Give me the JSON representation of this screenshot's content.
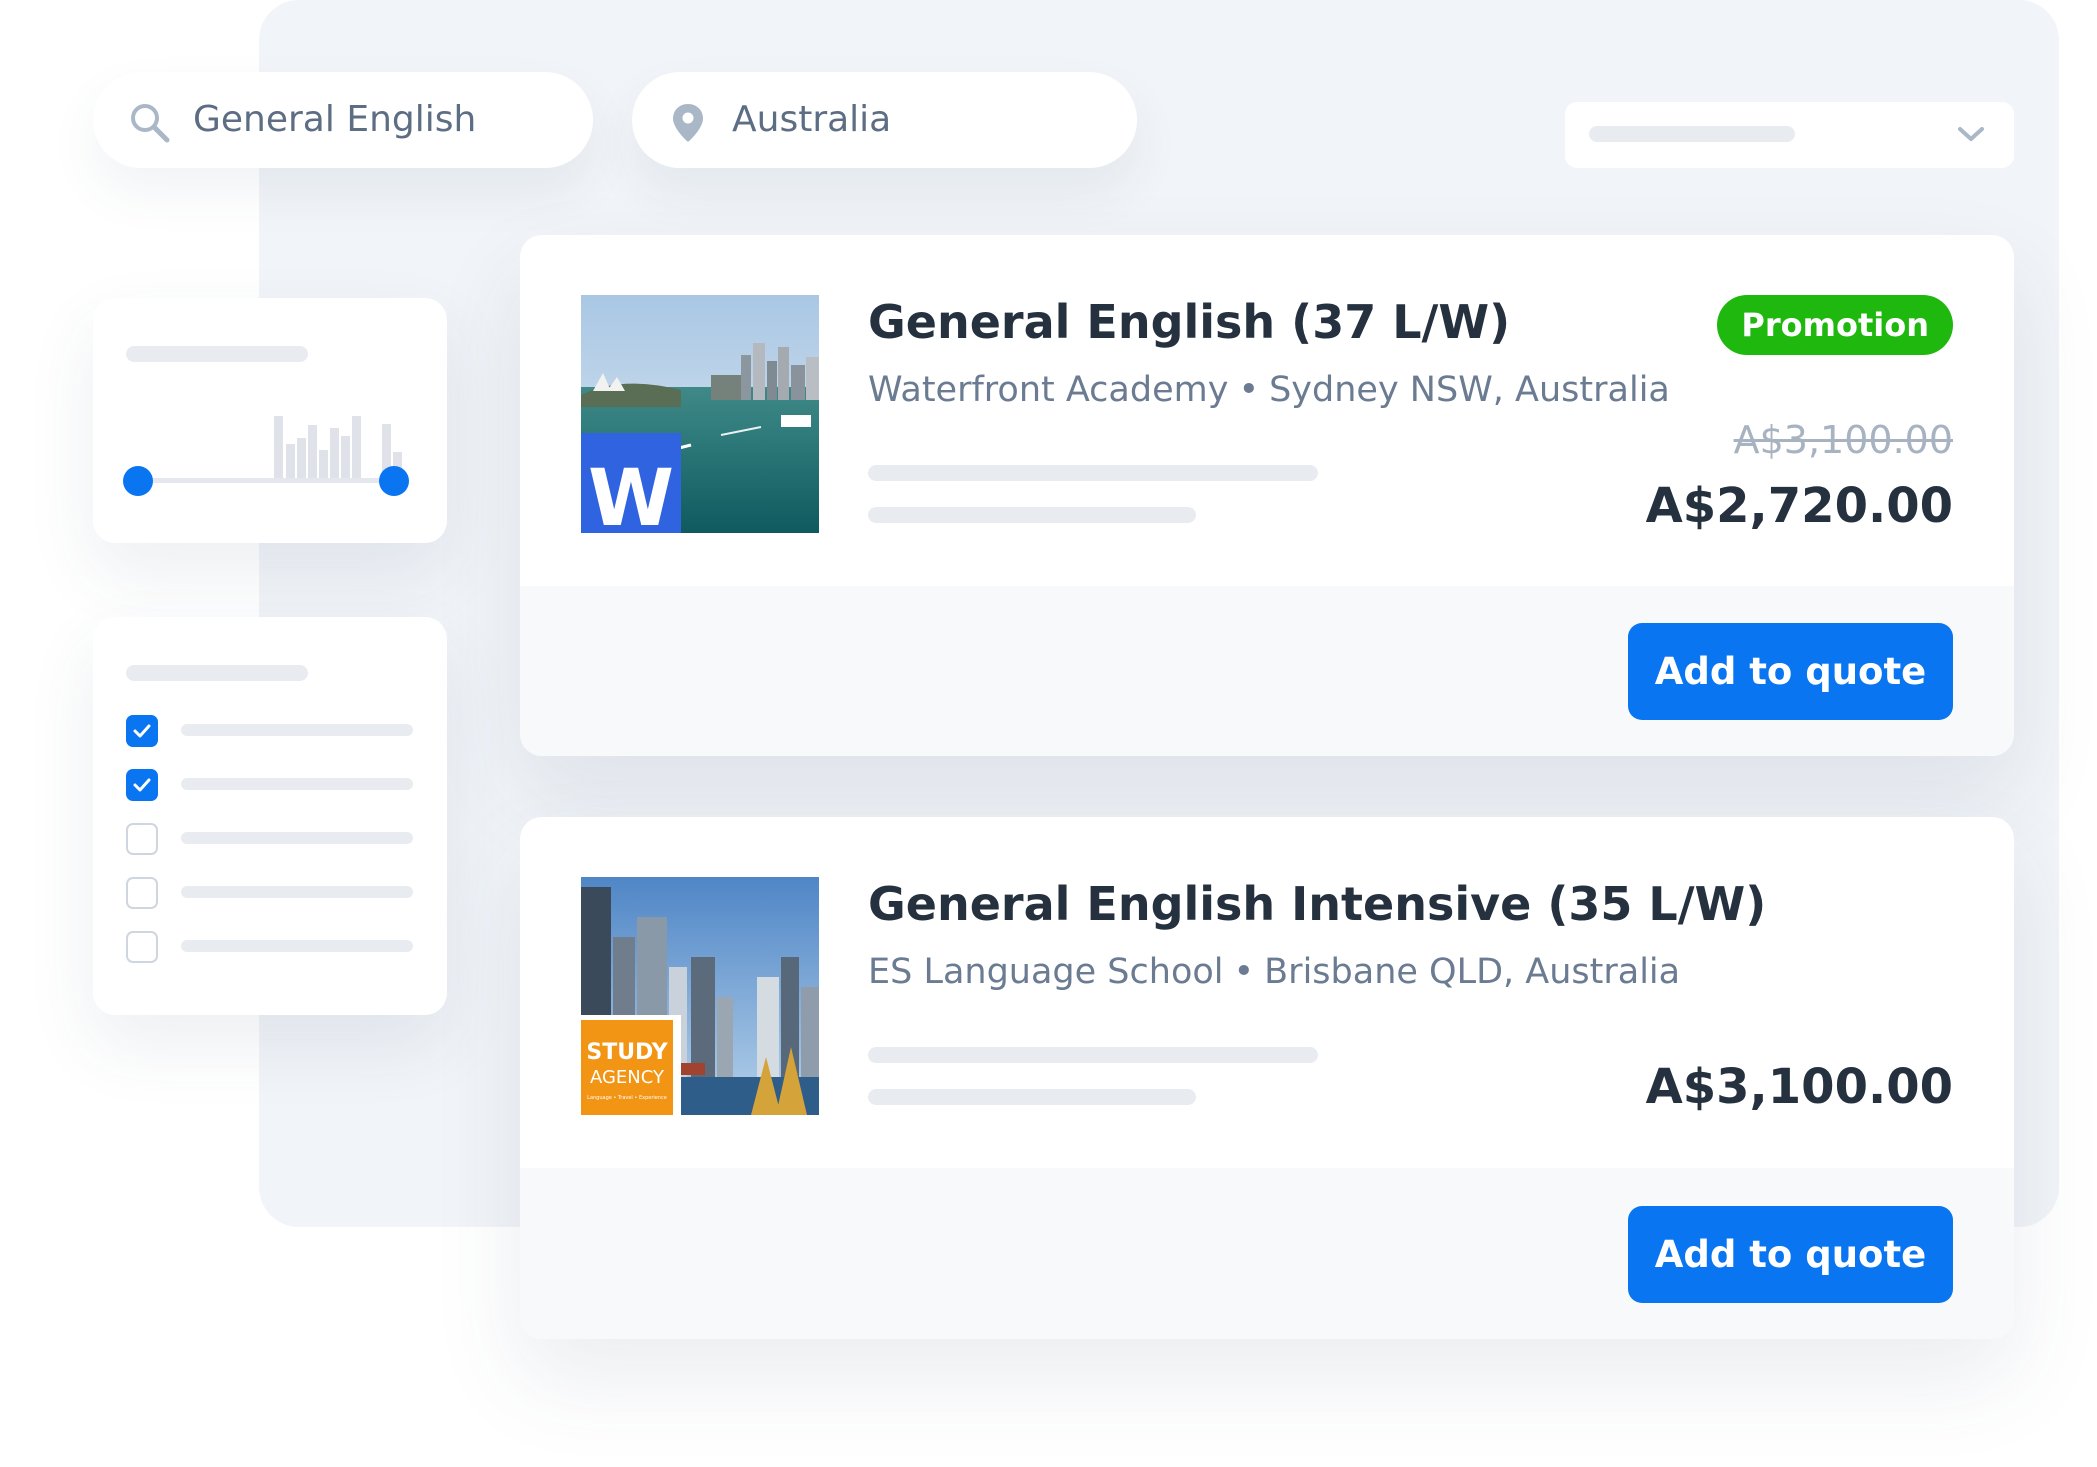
{
  "search": {
    "keyword_value": "General English",
    "location_value": "Australia"
  },
  "icons": {
    "search": "search-icon",
    "location": "map-pin-icon",
    "dropdown": "chevron-down-icon",
    "check": "check-icon"
  },
  "sort": {
    "selected_label": ""
  },
  "filters": {
    "price_range": {
      "min_fraction": 0.0,
      "max_fraction": 1.0
    },
    "checkboxes": [
      {
        "checked": true
      },
      {
        "checked": true
      },
      {
        "checked": false
      },
      {
        "checked": false
      },
      {
        "checked": false
      }
    ]
  },
  "results": [
    {
      "title": "General English (37 L/W)",
      "school": "Waterfront Academy",
      "location": "Sydney NSW, Australia",
      "badge": "Promotion",
      "original_price": "A$3,100.00",
      "price": "A$2,720.00",
      "button_label": "Add to quote",
      "logo_text": "W"
    },
    {
      "title": "General English Intensive (35 L/W)",
      "school": "ES Language School",
      "location": "Brisbane QLD, Australia",
      "price": "A$3,100.00",
      "button_label": "Add to quote",
      "logo_line1": "STUDY",
      "logo_line2": "AGENCY",
      "logo_line3": "Language • Travel • Experience"
    }
  ],
  "colors": {
    "accent": "#0a75f0",
    "promotion": "#1fb80f",
    "panel_bg": "#f1f4f8",
    "logo_w": "#2f63e0",
    "logo_study": "#f29414"
  }
}
